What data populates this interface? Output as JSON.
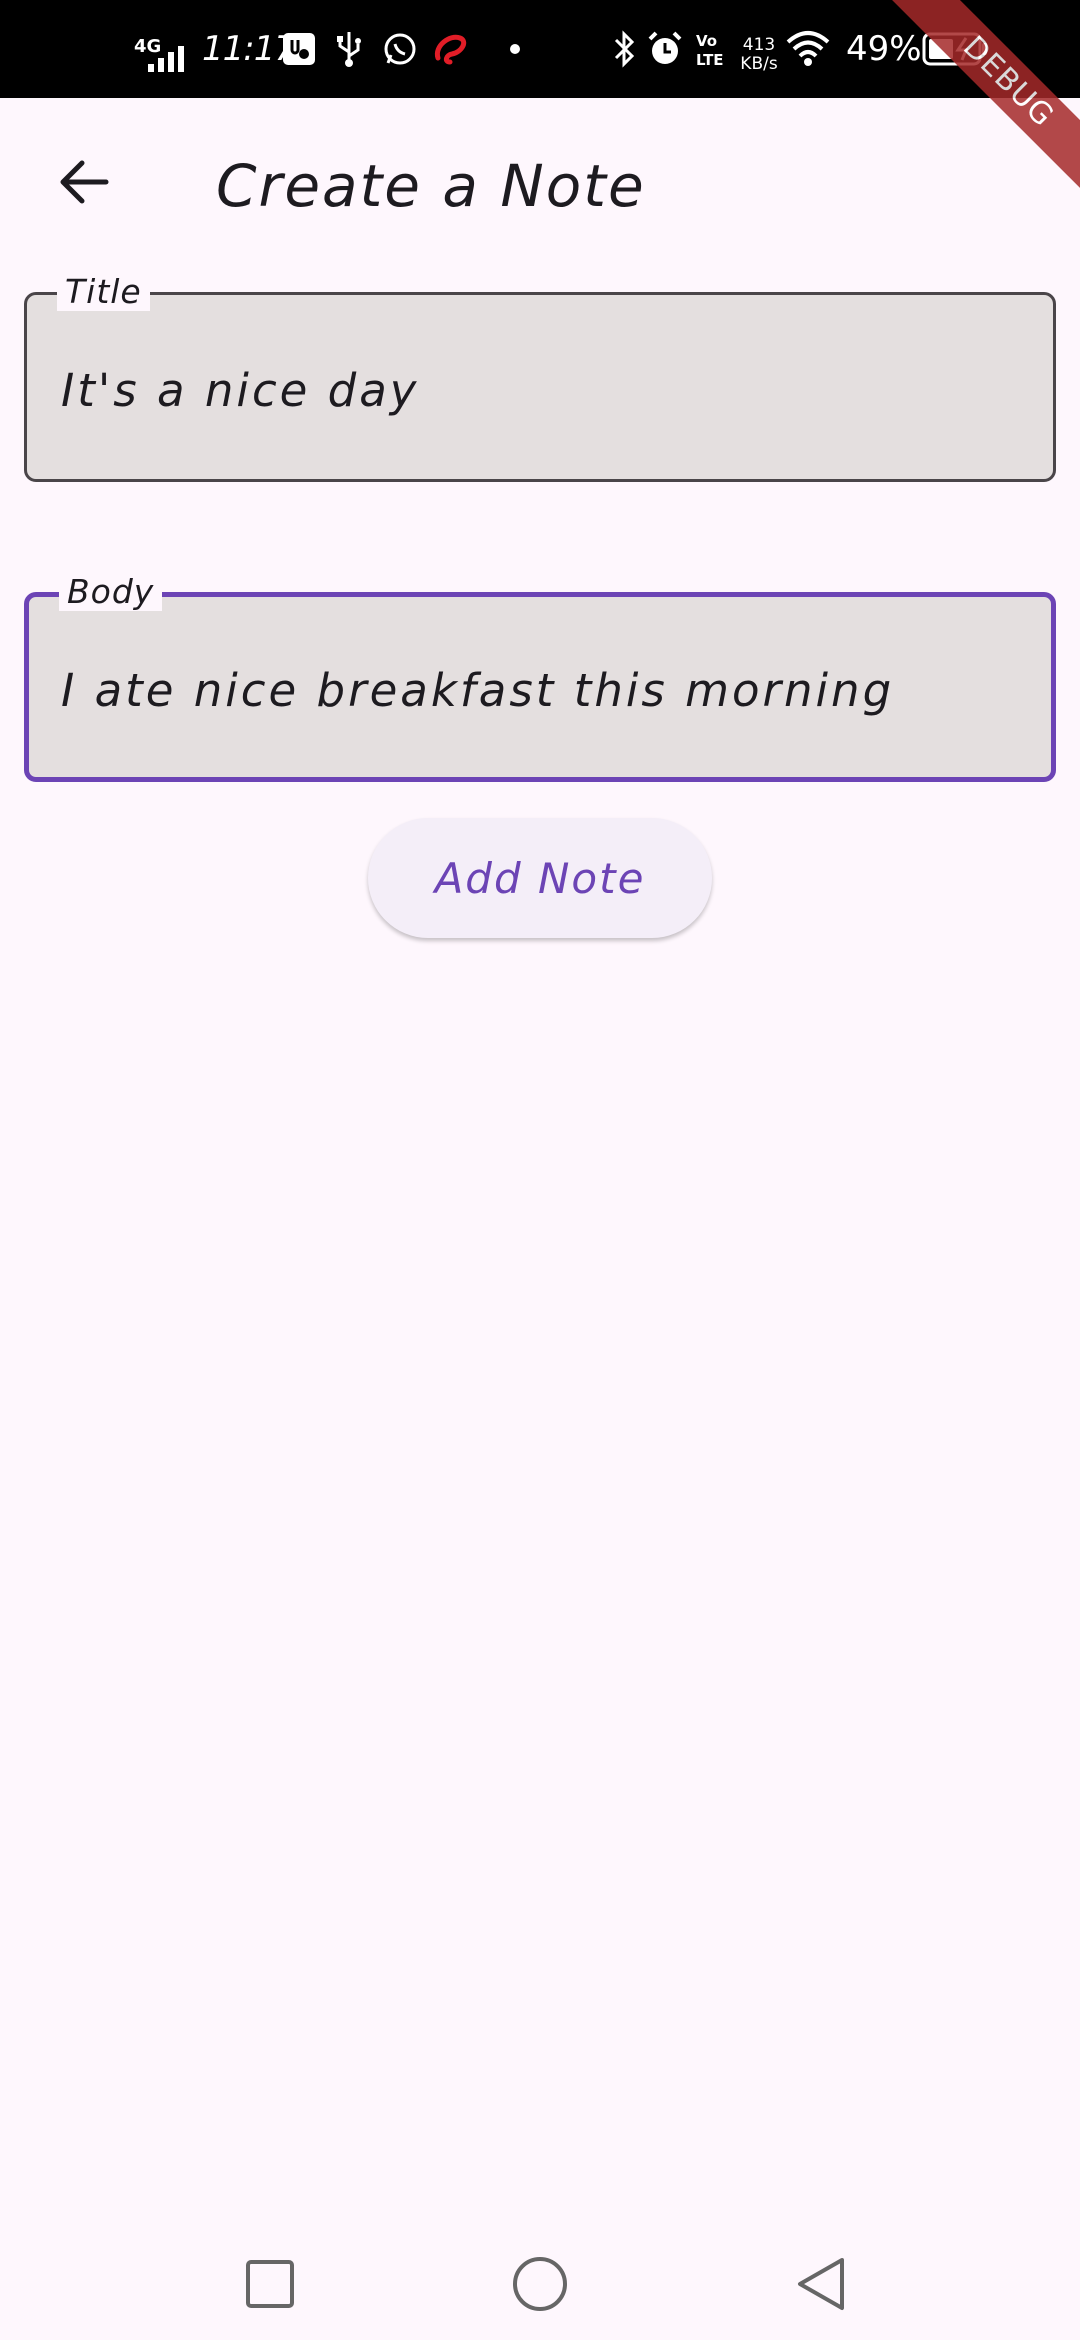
{
  "status_bar": {
    "network_type": "4G",
    "time": "11:17",
    "net_speed_value": "413",
    "net_speed_unit": "KB/s",
    "battery_percent": "49%"
  },
  "debug_banner": "DEBUG",
  "app_bar": {
    "title": "Create a Note",
    "back_icon": "arrow-left-icon"
  },
  "form": {
    "title_field": {
      "label": "Title",
      "value": "It's a nice day"
    },
    "body_field": {
      "label": "Body",
      "value": "I ate nice breakfast this morning",
      "focused": true
    },
    "submit_label": "Add Note"
  },
  "nav_bar": {
    "recents_icon": "square-icon",
    "home_icon": "circle-icon",
    "back_icon": "triangle-back-icon"
  },
  "colors": {
    "background": "#FEF7FD",
    "primary": "#6C44B5",
    "field_fill": "#E4DFDF",
    "field_border": "#4A4549",
    "debug_banner": "#A52A2A"
  }
}
